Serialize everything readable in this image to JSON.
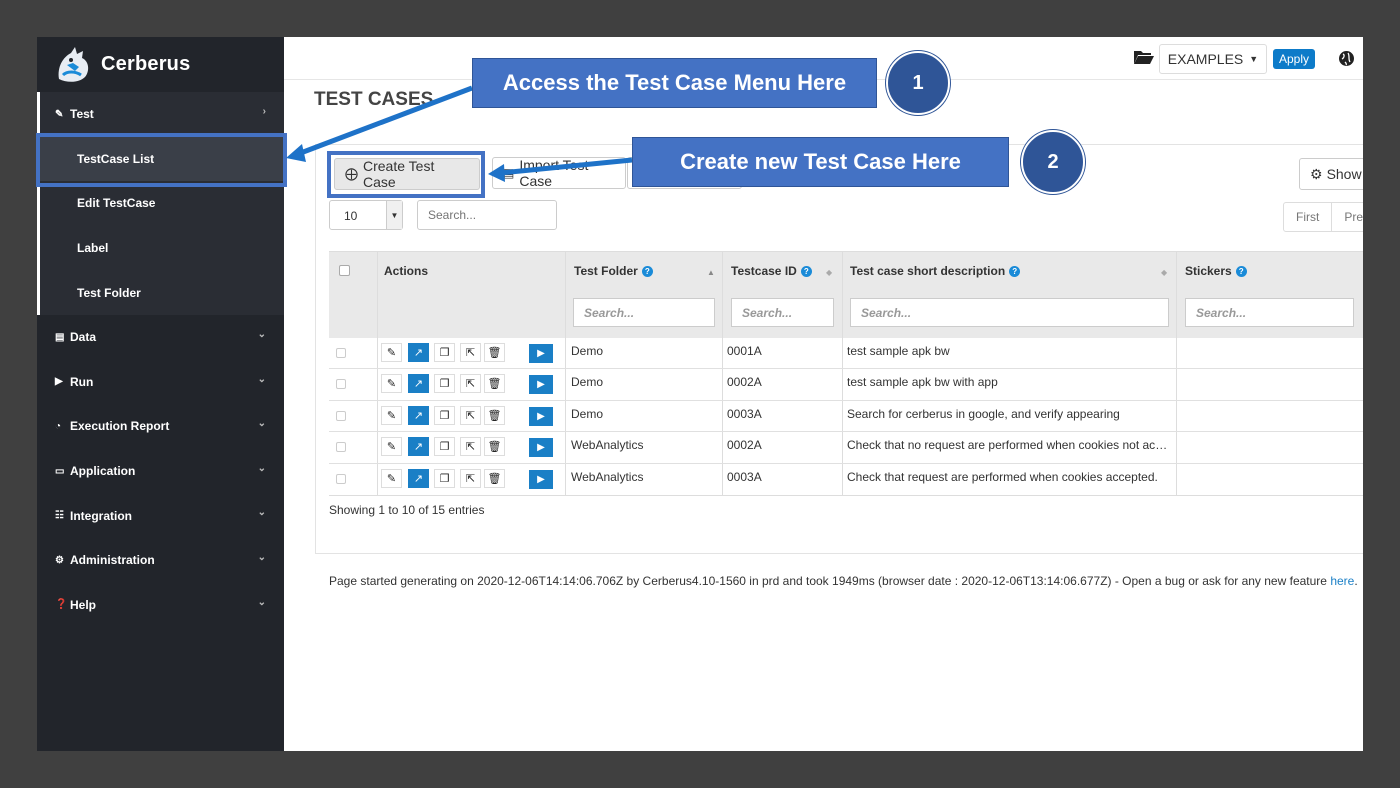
{
  "brand": {
    "name": "Cerberus"
  },
  "sidebar": {
    "test_group": {
      "label": "Test",
      "items": [
        "TestCase List",
        "Edit TestCase",
        "Label",
        "Test Folder"
      ]
    },
    "groups": [
      {
        "label": "Data",
        "icon": "database-icon"
      },
      {
        "label": "Run",
        "icon": "play-circle-icon"
      },
      {
        "label": "Execution Report",
        "icon": "pie-chart-icon"
      },
      {
        "label": "Application",
        "icon": "laptop-icon"
      },
      {
        "label": "Integration",
        "icon": "sitemap-icon"
      },
      {
        "label": "Administration",
        "icon": "cogs-icon"
      },
      {
        "label": "Help",
        "icon": "question-circle-icon"
      }
    ]
  },
  "topbar": {
    "system": "EXAMPLES",
    "apply_label": "Apply"
  },
  "page": {
    "title": "TEST CASES"
  },
  "toolbar": {
    "create_label": "Create Test Case",
    "import_label": "Import Test Case",
    "show_label": "Show",
    "page_length": "10",
    "search_placeholder": "Search...",
    "pager": [
      "First",
      "Prev"
    ]
  },
  "table": {
    "headers": {
      "actions": "Actions",
      "test_folder": "Test Folder",
      "testcase_id": "Testcase ID",
      "description": "Test case short description",
      "stickers": "Stickers"
    },
    "column_search_placeholder": "Search...",
    "rows": [
      {
        "folder": "Demo",
        "id": "0001A",
        "description": "test sample apk bw"
      },
      {
        "folder": "Demo",
        "id": "0002A",
        "description": "test sample apk bw with app"
      },
      {
        "folder": "Demo",
        "id": "0003A",
        "description": "Search for cerberus in google, and verify appearing"
      },
      {
        "folder": "WebAnalytics",
        "id": "0002A",
        "description": "Check that no request are performed when cookies not accepted."
      },
      {
        "folder": "WebAnalytics",
        "id": "0003A",
        "description": "Check that request are performed when cookies accepted."
      }
    ]
  },
  "entries_info": "Showing 1 to 10 of 15 entries",
  "footer": {
    "text": "Page started generating on 2020-12-06T14:14:06.706Z by Cerberus4.10-1560 in prd and took 1949ms (browser date : 2020-12-06T13:14:06.677Z) - Open a bug or ask for any new feature ",
    "link": "here",
    "end": "."
  },
  "callouts": {
    "one": {
      "text": "Access the Test Case Menu Here",
      "number": "1"
    },
    "two": {
      "text": "Create new Test Case Here",
      "number": "2"
    }
  },
  "colors": {
    "sidebar_bg": "#22252b",
    "accent": "#1a7fc6",
    "callout": "#4472c4",
    "callout_badge": "#2f5597"
  }
}
